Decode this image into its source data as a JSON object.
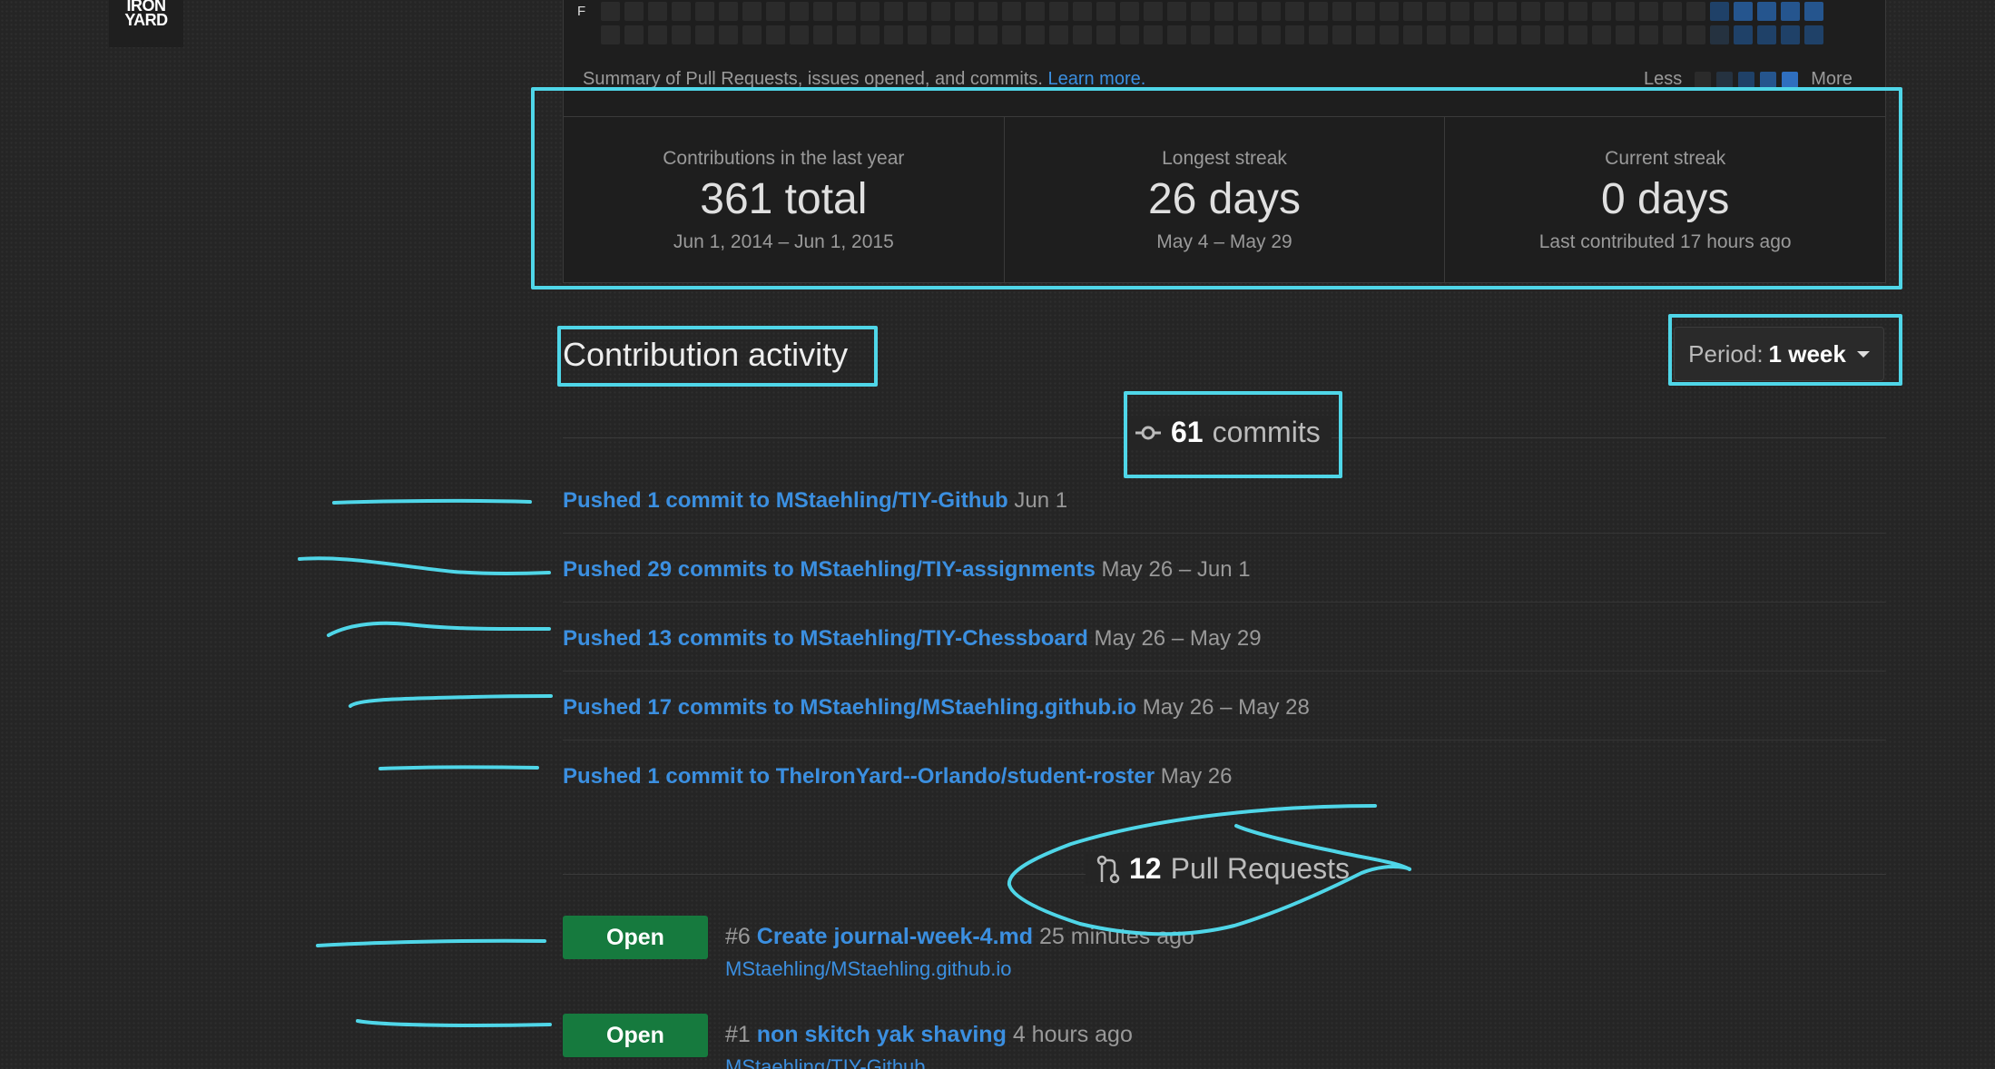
{
  "logo": {
    "line1": "IRON",
    "line2": "YARD"
  },
  "calendar": {
    "day_label": "F",
    "summary_text": "Summary of Pull Requests, issues opened, and commits.",
    "learn_more": "Learn more.",
    "legend_less": "Less",
    "legend_more": "More",
    "legend_colors": [
      "#2b2b2b",
      "#253240",
      "#1f4168",
      "#25558e",
      "#2f6fbf"
    ]
  },
  "stats": [
    {
      "label": "Contributions in the last year",
      "value": "361 total",
      "sub": "Jun 1, 2014 – Jun 1, 2015"
    },
    {
      "label": "Longest streak",
      "value": "26 days",
      "sub": "May 4 – May 29"
    },
    {
      "label": "Current streak",
      "value": "0 days",
      "sub": "Last contributed 17 hours ago"
    }
  ],
  "activity": {
    "title": "Contribution activity",
    "period_label": "Period:",
    "period_value": "1 week"
  },
  "commits_header": {
    "count": "61",
    "label": "commits"
  },
  "commits": [
    {
      "link": "Pushed 1 commit to MStaehling/TIY-Github",
      "date": "Jun 1"
    },
    {
      "link": "Pushed 29 commits to MStaehling/TIY-assignments",
      "date": "May 26 – Jun 1"
    },
    {
      "link": "Pushed 13 commits to MStaehling/TIY-Chessboard",
      "date": "May 26 – May 29"
    },
    {
      "link": "Pushed 17 commits to MStaehling/MStaehling.github.io",
      "date": "May 26 – May 28"
    },
    {
      "link": "Pushed 1 commit to TheIronYard--Orlando/student-roster",
      "date": "May 26"
    }
  ],
  "pulls_header": {
    "count": "12",
    "label": "Pull Requests"
  },
  "pulls": [
    {
      "status": "Open",
      "number": "#6",
      "title": "Create journal-week-4.md",
      "time": "25 minutes ago",
      "repo": "MStaehling/MStaehling.github.io"
    },
    {
      "status": "Open",
      "number": "#1",
      "title": "non skitch yak shaving",
      "time": "4 hours ago",
      "repo": "MStaehling/TIY-Github"
    }
  ],
  "annotation_color": "#4fd6e8"
}
